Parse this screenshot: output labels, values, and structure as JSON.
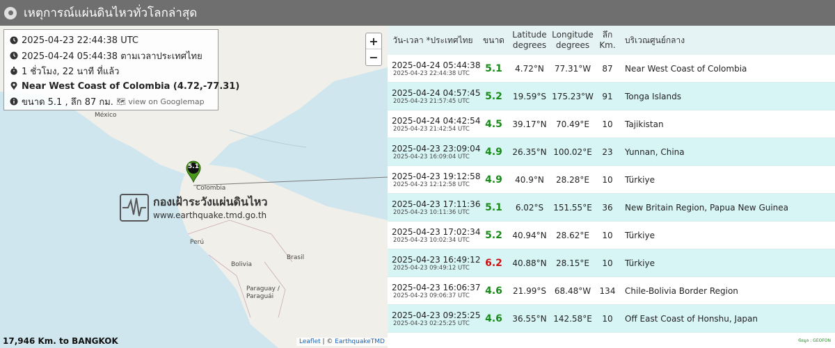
{
  "header": {
    "title": "เหตุการณ์แผ่นดินไหวทั่วโลกล่าสุด"
  },
  "info": {
    "utc": "2025-04-23 22:44:38 UTC",
    "thai_time": "2025-04-24 05:44:38 ตามเวลาประเทศไทย",
    "elapsed": "1 ชั่วโมง, 22 นาที ที่แล้ว",
    "location": "Near West Coast of Colombia (4.72,-77.31)",
    "magnitude_depth": "ขนาด 5.1 , ลึก 87 กม.",
    "googlemap": "view on Googlemap"
  },
  "map": {
    "zoom_in": "+",
    "zoom_out": "−",
    "marker_label": "5.1",
    "labels": {
      "mexico": "México",
      "colombia": "Colombia",
      "peru": "Perú",
      "brasil": "Brasil",
      "bolivia": "Bolivia",
      "paraguay": "Paraguay / Paraguái"
    },
    "watermark_title": "กองเฝ้าระวังแผ่นดินไหว",
    "watermark_url": "www.earthquake.tmd.go.th",
    "distance": "17,946 Km. to BANGKOK",
    "attribution_leaflet": "Leaflet",
    "attribution_sep": " | © ",
    "attribution_owner": "EarthquakeTMD"
  },
  "table": {
    "headers": {
      "datetime": "วัน-เวลา *ประเทศไทย",
      "magnitude": "ขนาด",
      "lat_1": "Latitude",
      "lat_2": "degrees",
      "lon_1": "Longitude",
      "lon_2": "degrees",
      "depth_1": "ลึก",
      "depth_2": "Km.",
      "region": "บริเวณศูนย์กลาง"
    },
    "rows": [
      {
        "local": "2025-04-24 05:44:38",
        "utc": "2025-04-23 22:44:38 UTC",
        "mag": "5.1",
        "lat": "4.72°N",
        "lon": "77.31°W",
        "depth": "87",
        "region": "Near West Coast of Colombia"
      },
      {
        "local": "2025-04-24 04:57:45",
        "utc": "2025-04-23 21:57:45 UTC",
        "mag": "5.2",
        "lat": "19.59°S",
        "lon": "175.23°W",
        "depth": "91",
        "region": "Tonga Islands"
      },
      {
        "local": "2025-04-24 04:42:54",
        "utc": "2025-04-23 21:42:54 UTC",
        "mag": "4.5",
        "lat": "39.17°N",
        "lon": "70.49°E",
        "depth": "10",
        "region": "Tajikistan"
      },
      {
        "local": "2025-04-23 23:09:04",
        "utc": "2025-04-23 16:09:04 UTC",
        "mag": "4.9",
        "lat": "26.35°N",
        "lon": "100.02°E",
        "depth": "23",
        "region": "Yunnan, China"
      },
      {
        "local": "2025-04-23 19:12:58",
        "utc": "2025-04-23 12:12:58 UTC",
        "mag": "4.9",
        "lat": "40.9°N",
        "lon": "28.28°E",
        "depth": "10",
        "region": "Türkiye"
      },
      {
        "local": "2025-04-23 17:11:36",
        "utc": "2025-04-23 10:11:36 UTC",
        "mag": "5.1",
        "lat": "6.02°S",
        "lon": "151.55°E",
        "depth": "36",
        "region": "New Britain Region, Papua New Guinea"
      },
      {
        "local": "2025-04-23 17:02:34",
        "utc": "2025-04-23 10:02:34 UTC",
        "mag": "5.2",
        "lat": "40.94°N",
        "lon": "28.62°E",
        "depth": "10",
        "region": "Türkiye"
      },
      {
        "local": "2025-04-23 16:49:12",
        "utc": "2025-04-23 09:49:12 UTC",
        "mag": "6.2",
        "lat": "40.88°N",
        "lon": "28.15°E",
        "depth": "10",
        "region": "Türkiye"
      },
      {
        "local": "2025-04-23 16:06:37",
        "utc": "2025-04-23 09:06:37 UTC",
        "mag": "4.6",
        "lat": "21.99°S",
        "lon": "68.48°W",
        "depth": "134",
        "region": "Chile-Bolivia Border Region"
      },
      {
        "local": "2025-04-23 09:25:25",
        "utc": "2025-04-23 02:25:25 UTC",
        "mag": "4.6",
        "lat": "36.55°N",
        "lon": "142.58°E",
        "depth": "10",
        "region": "Off East Coast of Honshu, Japan"
      }
    ],
    "source": "ข้อมูล : GEOFON"
  },
  "colors": {
    "mag_green": "#1a8a1a",
    "mag_red": "#d01010",
    "alt_row": "#d8f5f6"
  }
}
